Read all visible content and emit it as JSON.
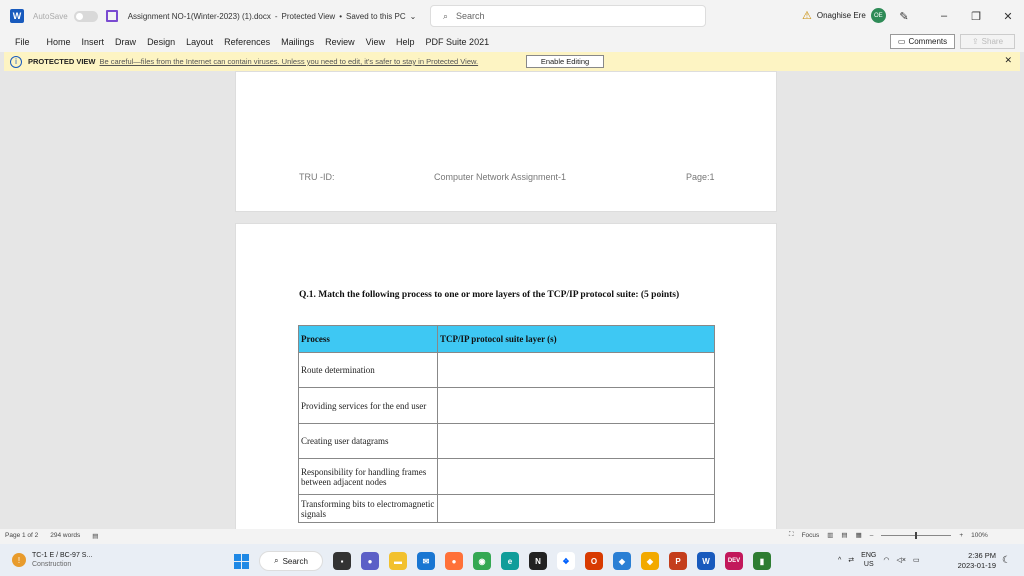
{
  "titlebar": {
    "autosave_label": "AutoSave",
    "toggle_state": "Off",
    "doc_title": "Assignment NO-1(Winter-2023) (1).docx",
    "protected_view": "Protected View",
    "saved_status": "Saved to this PC",
    "search_placeholder": "Search",
    "user_name": "Onaghise Ere",
    "user_initials": "OE"
  },
  "menu": {
    "items": [
      "File",
      "Home",
      "Insert",
      "Draw",
      "Design",
      "Layout",
      "References",
      "Mailings",
      "Review",
      "View",
      "Help",
      "PDF Suite 2021"
    ],
    "comments_label": "Comments",
    "share_label": "Share"
  },
  "protected_bar": {
    "label": "PROTECTED VIEW",
    "message": "Be careful—files from the Internet can contain viruses. Unless you need to edit, it's safer to stay in Protected View.",
    "button": "Enable Editing"
  },
  "page1_header": {
    "left": "TRU -ID:",
    "center": "Computer Network Assignment-1",
    "right": "Page:1"
  },
  "question": "Q.1. Match the following process to one or more layers of the TCP/IP protocol suite: (5 points)",
  "table": {
    "headers": [
      "Process",
      "TCP/IP protocol suite layer (s)"
    ],
    "rows": [
      [
        "Route determination",
        ""
      ],
      [
        "Providing services for the end user",
        ""
      ],
      [
        "Creating user datagrams",
        ""
      ],
      [
        "Responsibility for handling frames between adjacent nodes",
        ""
      ],
      [
        "Transforming bits to electromagnetic signals",
        ""
      ]
    ]
  },
  "statusbar": {
    "page": "Page 1 of 2",
    "words": "294 words",
    "focus": "Focus",
    "zoom": "100%"
  },
  "taskbar": {
    "weather_title": "TC-1 E / BC-97 S...",
    "weather_sub": "Construction",
    "search_label": "Search",
    "lang": "ENG",
    "region": "US",
    "time": "2:36 PM",
    "date": "2023-01-19"
  },
  "colors": {
    "table_header": "#3ec8f3",
    "protected_bar": "#fdf4c3",
    "word_blue": "#185abd"
  }
}
